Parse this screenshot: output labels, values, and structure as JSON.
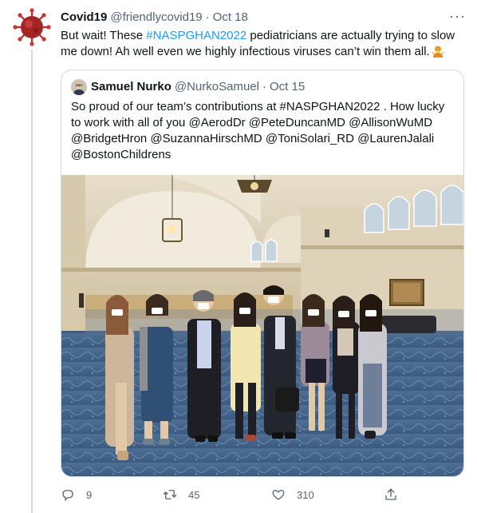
{
  "tweet": {
    "author_name": "Covid19",
    "author_handle": "@friendlycovid19",
    "separator": "·",
    "date": "Oct 18",
    "text_before": "But wait! These ",
    "hashtag": "#NASPGHAN2022",
    "text_after": " pediatricians are actually trying to slow me down! Ah well even we highly infectious viruses can’t win them all."
  },
  "quoted": {
    "author_name": "Samuel Nurko",
    "author_handle": "@NurkoSamuel",
    "separator": "·",
    "date": "Oct 15",
    "text": "So proud of our team’s contributions at #NASPGHAN2022 . How lucky to work with all of you @AerodDr @PeteDuncanMD @AllisonWuMD @BridgetHron @SuzannaHirschMD @ToniSolari_RD @LaurenJalali @BostonChildrens"
  },
  "actions": {
    "replies": "9",
    "retweets": "45",
    "likes": "310"
  },
  "colors": {
    "accent": "#1d9bf0",
    "muted": "#536471",
    "border": "#cfd9de"
  },
  "icons": [
    "virus-avatar-icon",
    "more-icon",
    "person-shrug-emoji-icon",
    "reply-icon",
    "retweet-icon",
    "like-icon",
    "share-icon"
  ]
}
